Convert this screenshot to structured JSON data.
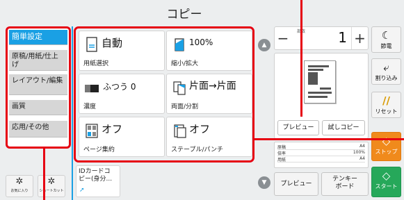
{
  "header": {
    "title": "コピー"
  },
  "left_menu": {
    "items": [
      {
        "label": "簡単設定",
        "active": true
      },
      {
        "label": "原稿/用紙/仕上げ"
      },
      {
        "label": "レイアウト/編集"
      },
      {
        "label": "画質"
      },
      {
        "label": "応用/その他"
      }
    ]
  },
  "shortcuts": {
    "favorites_label": "お気に入り",
    "shortcut_label": "ショートカット"
  },
  "functions": {
    "paper": {
      "value": "自動",
      "label": "用紙選択"
    },
    "zoom": {
      "value": "100%",
      "label": "縮小/拡大"
    },
    "density": {
      "value": "ふつう 0",
      "label": "濃度"
    },
    "duplex": {
      "value": "片面→片面",
      "label": "両面/分割"
    },
    "combine": {
      "value": "オフ",
      "label": "ページ集約"
    },
    "staple": {
      "value": "オフ",
      "label": "ステープル/パンチ"
    },
    "id_card": {
      "line1": "IDカードコ",
      "line2": "ピー(身分..."
    }
  },
  "copies": {
    "label": "部数",
    "value": "1",
    "minus": "−",
    "plus": "+"
  },
  "preview": {
    "preview_button": "プレビュー",
    "trial_copy_button": "試しコピー"
  },
  "info": {
    "rows": [
      {
        "k": "原稿",
        "v": "A4"
      },
      {
        "k": "倍率",
        "v": "100%"
      },
      {
        "k": "用紙",
        "v": "A4"
      }
    ]
  },
  "bottom": {
    "preview_button": "プレビュー",
    "tenkey_line1": "テンキー",
    "tenkey_line2": "ボード"
  },
  "right_column": {
    "energy_saver": "節電",
    "interrupt": "割り込み",
    "reset": "リセット",
    "stop": "ストップ",
    "start": "スタート"
  },
  "colors": {
    "accent_blue": "#1aa0e4",
    "callout_red": "#e60012",
    "stop_orange": "#f08a1c",
    "start_green": "#26a85a"
  }
}
